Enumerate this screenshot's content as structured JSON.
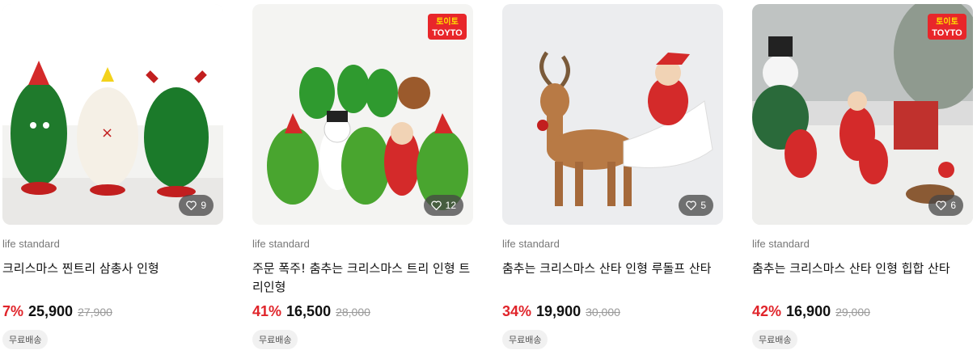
{
  "products": [
    {
      "brand": "life standard",
      "title": "크리스마스 찐트리 삼총사 인형",
      "discount": "7%",
      "price": "25,900",
      "original_price": "27,900",
      "likes": "9",
      "badge": "무료배송",
      "has_logo": false
    },
    {
      "brand": "life standard",
      "title": "주문 폭주! 춤추는 크리스마스 트리 인형 트리인형",
      "discount": "41%",
      "price": "16,500",
      "original_price": "28,000",
      "likes": "12",
      "badge": "무료배송",
      "has_logo": true,
      "logo_text_top": "토이토",
      "logo_text_bottom": "TOYTO"
    },
    {
      "brand": "life standard",
      "title": "춤추는 크리스마스 산타 인형 루돌프 산타",
      "discount": "34%",
      "price": "19,900",
      "original_price": "30,000",
      "likes": "5",
      "badge": "무료배송",
      "has_logo": false
    },
    {
      "brand": "life standard",
      "title": "춤추는 크리스마스 산타 인형 힙합 산타",
      "discount": "42%",
      "price": "16,900",
      "original_price": "29,000",
      "likes": "6",
      "badge": "무료배송",
      "has_logo": true,
      "logo_text_top": "토이토",
      "logo_text_bottom": "TOYTO"
    }
  ],
  "colors": {
    "discount": "#e0242a",
    "badge_bg": "#f1f1f1",
    "like_bg": "#464646"
  },
  "icons": {
    "like": "heart-icon"
  }
}
